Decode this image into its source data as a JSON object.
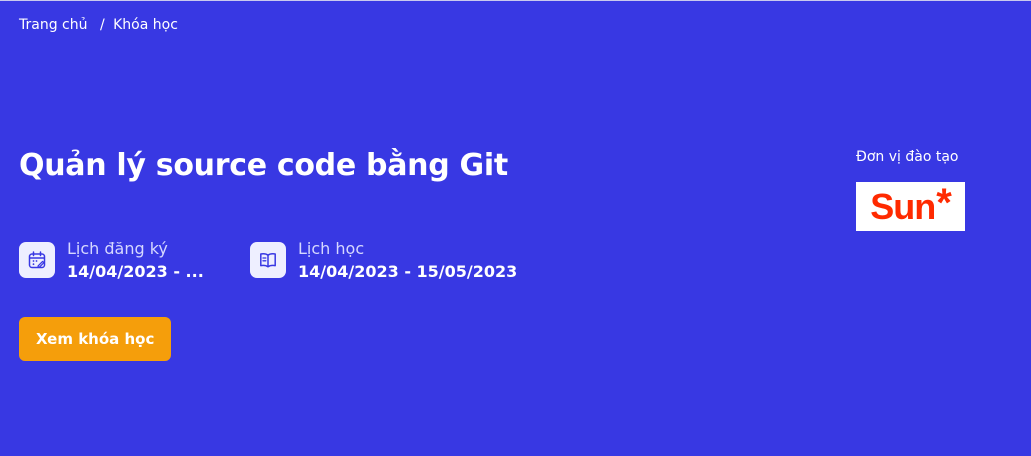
{
  "theme": {
    "background": "#3838e3",
    "accent": "#f59e0b",
    "icon_color": "#3838e3",
    "logo_red": "#ff2a00"
  },
  "breadcrumb": {
    "home": "Trang chủ",
    "separator": "/",
    "current": "Khóa học"
  },
  "course": {
    "title": "Quản lý source code bằng Git",
    "registration": {
      "icon": "calendar-edit-icon",
      "label": "Lịch đăng ký",
      "value": "14/04/2023 - ..."
    },
    "schedule": {
      "icon": "book-open-icon",
      "label": "Lịch học",
      "value": "14/04/2023 - 15/05/2023"
    },
    "cta_label": "Xem khóa học"
  },
  "provider": {
    "label": "Đơn vị đào tạo",
    "logo_text": "Sun",
    "logo_mark": "*"
  }
}
